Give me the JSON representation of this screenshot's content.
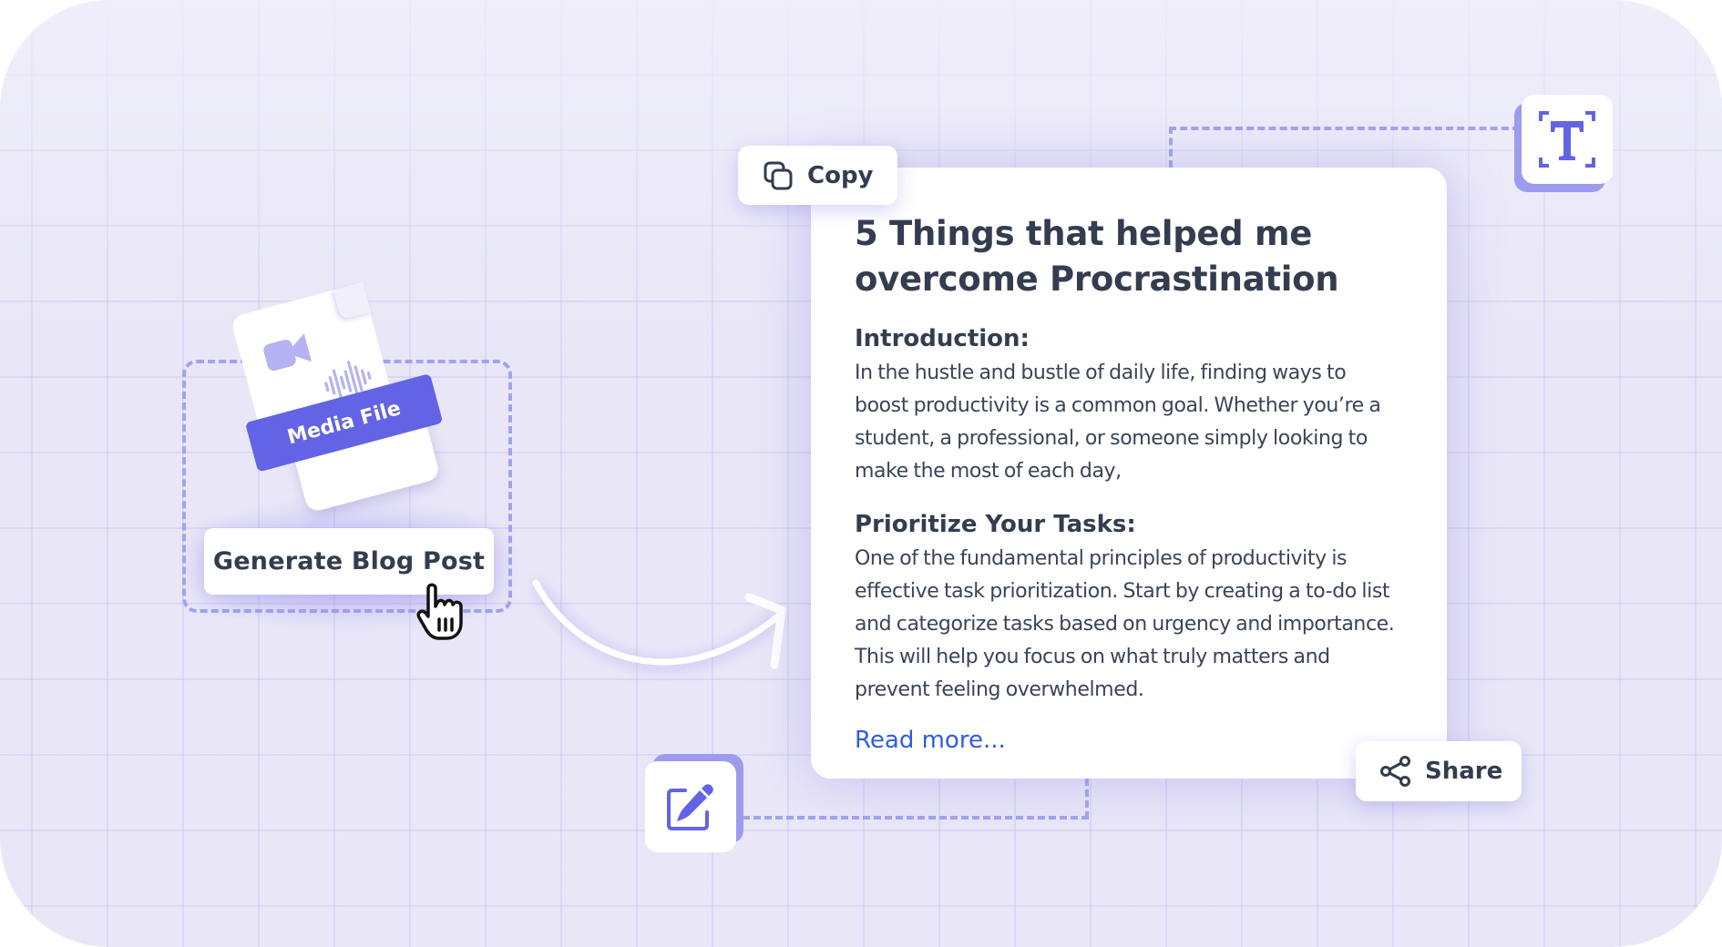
{
  "media_card": {
    "label": "Media File",
    "icons": [
      "video-camera-icon",
      "audio-waveform-icon"
    ]
  },
  "generate_button": {
    "label": "Generate Blog Post",
    "cursor": "hand-pointer-cursor"
  },
  "copy_button": {
    "label": "Copy",
    "icon": "copy-icon"
  },
  "share_button": {
    "label": "Share",
    "icon": "share-icon"
  },
  "text_tool": {
    "icon": "text-select-icon",
    "glyph": "T"
  },
  "edit_tool": {
    "icon": "edit-icon"
  },
  "blog_post": {
    "title": "5 Things that helped me overcome Procrastination",
    "sections": [
      {
        "heading": "Introduction:",
        "body": "In the hustle and bustle of daily life, finding ways to boost productivity is a common goal. Whether you’re a student, a professional, or someone simply looking to make the most of each day,"
      },
      {
        "heading": "Prioritize Your Tasks:",
        "body": "One of the fundamental principles of productivity is effective task prioritization. Start by creating a to-do list and categorize tasks based on urgency and importance. This will help you focus on what truly matters and prevent feeling overwhelmed."
      }
    ],
    "read_more": "Read more..."
  },
  "colors": {
    "accent": "#6363e6",
    "dash": "#a3a2f0",
    "text": "#333d4f",
    "link": "#2f5ce6",
    "background": "#e9e7f7"
  }
}
